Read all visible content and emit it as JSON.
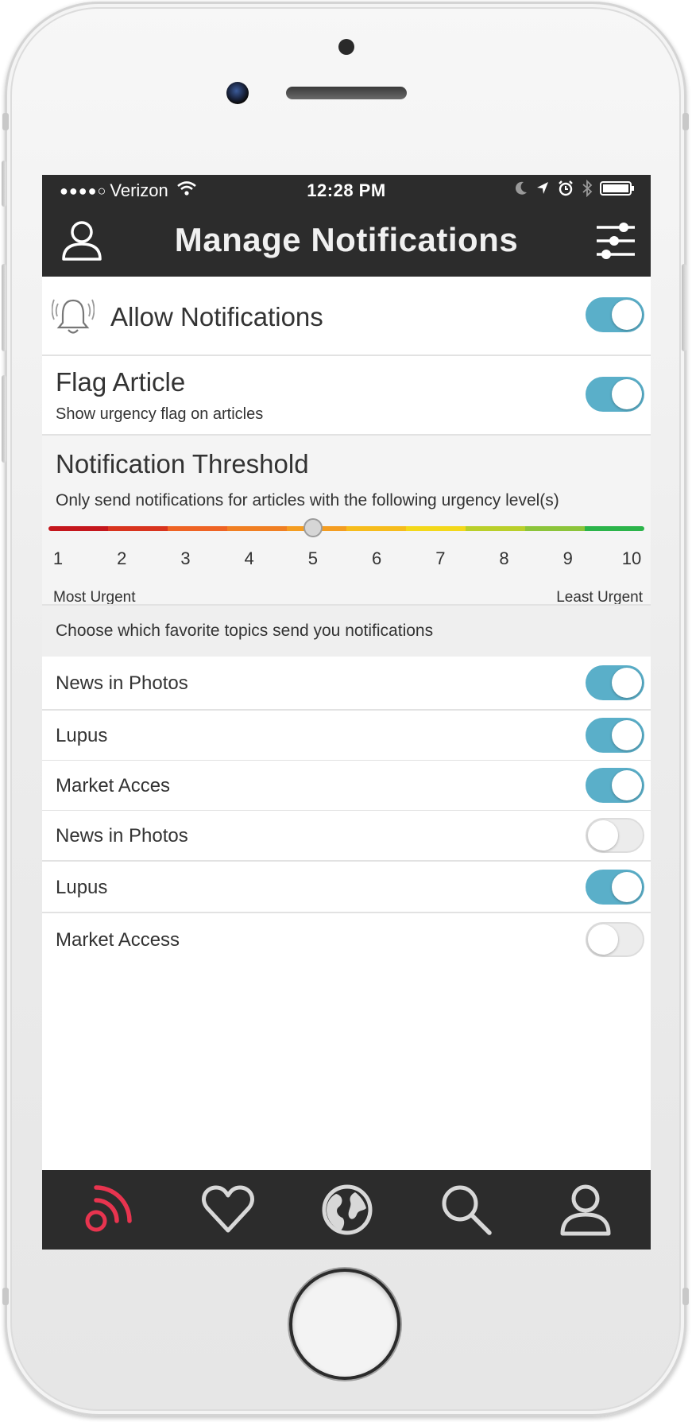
{
  "status_bar": {
    "signal": "●●●●○",
    "carrier": "Verizon",
    "time": "12:28 PM"
  },
  "header": {
    "title": "Manage Notifications"
  },
  "allow_notifications": {
    "label": "Allow Notifications",
    "enabled": true
  },
  "flag_article": {
    "title": "Flag Article",
    "subtitle": "Show urgency flag on articles",
    "enabled": true
  },
  "threshold": {
    "title": "Notification Threshold",
    "subtitle": "Only send notifications for articles with the following urgency level(s)",
    "levels": [
      "1",
      "2",
      "3",
      "4",
      "5",
      "6",
      "7",
      "8",
      "9",
      "10"
    ],
    "selected_level": 5,
    "min_label": "Most Urgent",
    "max_label": "Least Urgent",
    "gradient_colors": [
      "#c4161c",
      "#d8341e",
      "#ee6324",
      "#f07f23",
      "#f49d21",
      "#f6bc1c",
      "#f3d81a",
      "#b9cf2a",
      "#8cc43a",
      "#2bb44a"
    ]
  },
  "topics": {
    "section_label": "Choose which favorite topics send you notifications",
    "items": [
      {
        "label": "News in Photos",
        "enabled": true
      },
      {
        "label": "Lupus",
        "enabled": true
      },
      {
        "label": "Market Acces",
        "enabled": true
      },
      {
        "label": "News in Photos",
        "enabled": false
      },
      {
        "label": "Lupus",
        "enabled": true
      },
      {
        "label": "Market Access",
        "enabled": false
      }
    ]
  },
  "tab_bar": {
    "active_tab": "feed",
    "active_color": "#e8344f",
    "inactive_color": "#d8d8d8",
    "tabs": [
      "feed-icon",
      "heart-icon",
      "globe-icon",
      "search-icon",
      "profile-icon"
    ]
  },
  "colors": {
    "toggle_on": "#5aafc9",
    "bar_background": "#2c2c2c"
  }
}
